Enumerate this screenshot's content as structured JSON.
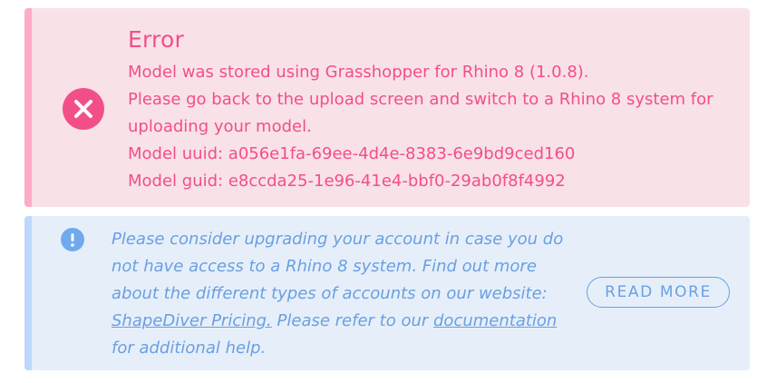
{
  "error": {
    "title": "Error",
    "lines": [
      "Model was stored using Grasshopper for Rhino 8 (1.0.8).",
      "Please go back to the upload screen and switch to a Rhino 8 system for",
      "uploading your model.",
      "Model uuid: a056e1fa-69ee-4d4e-8383-6e9bd9ced160",
      "Model guid: e8ccda25-1e96-41e4-bbf0-29ab0f8f4992"
    ],
    "icon": "close-circle-icon",
    "color": "#f24f88",
    "background": "#f9e1e8"
  },
  "info": {
    "icon": "exclamation-circle-icon",
    "text_line1": "Please consider upgrading your account in case you do",
    "text_line2": "not have access to a Rhino 8 system. Find out more",
    "text_line3": "about the different types of accounts on our website:",
    "pricing_link": "ShapeDiver Pricing.",
    "text_middle": " Please refer to our ",
    "docs_link": "documentation",
    "text_end": "for additional help.",
    "button_label": "READ MORE",
    "color": "#6a9fe3",
    "background": "#e6eff9"
  }
}
